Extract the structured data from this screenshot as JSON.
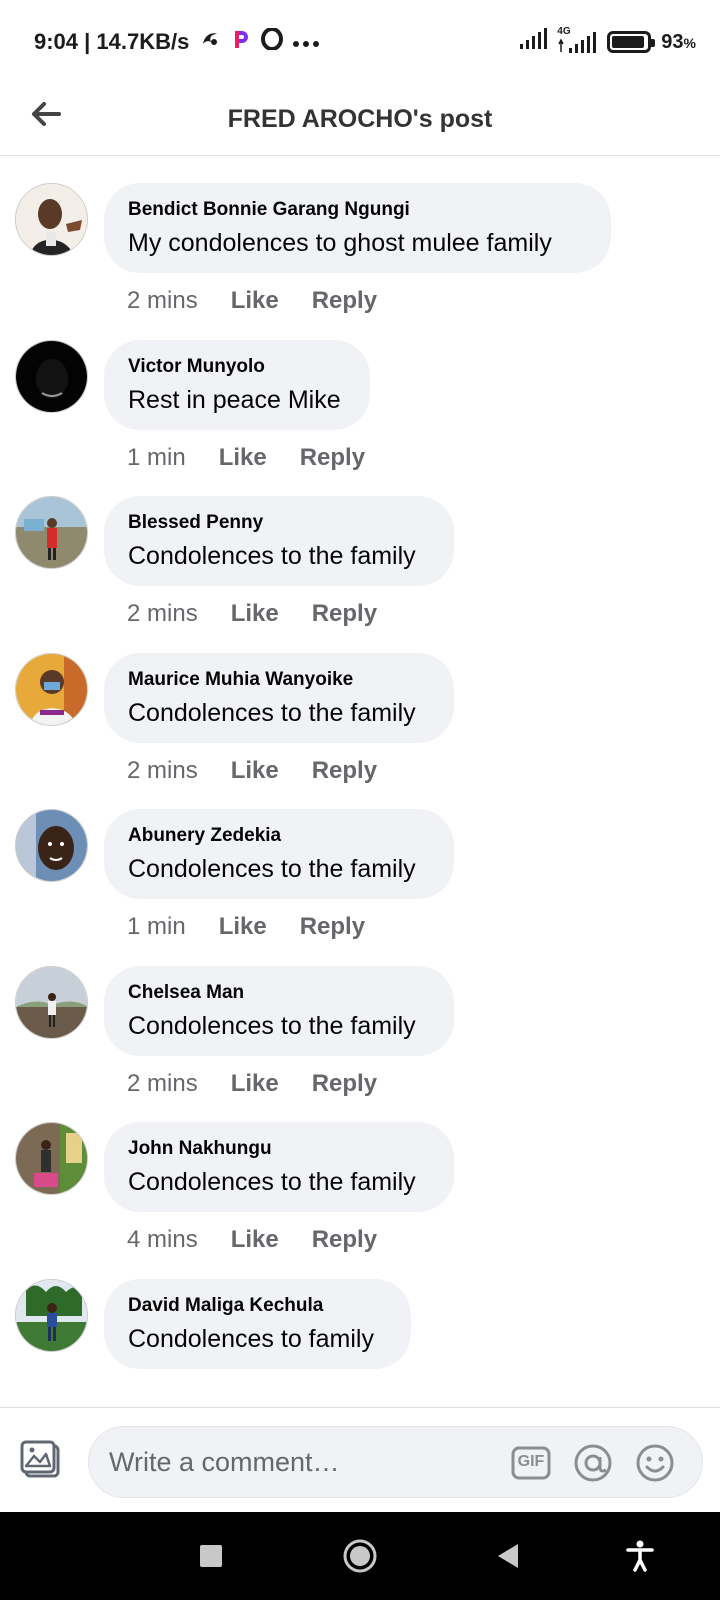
{
  "status_bar": {
    "time_speed": "9:04 | 14.7KB/s",
    "network": "4G",
    "battery_percent": "93",
    "battery_unit": "%",
    "battery_level": 0.93
  },
  "header": {
    "title": "FRED AROCHO's post"
  },
  "comments": [
    {
      "name": "Bendict Bonnie Garang Ngungi",
      "text": "My condolences to ghost mulee family",
      "time": "2 mins",
      "like": "Like",
      "reply": "Reply"
    },
    {
      "name": "Victor Munyolo",
      "text": "Rest in peace Mike",
      "time": "1 min",
      "like": "Like",
      "reply": "Reply"
    },
    {
      "name": "Blessed Penny",
      "text": "Condolences to the family",
      "time": "2 mins",
      "like": "Like",
      "reply": "Reply"
    },
    {
      "name": "Maurice Muhia Wanyoike",
      "text": "Condolences to the family",
      "time": "2 mins",
      "like": "Like",
      "reply": "Reply"
    },
    {
      "name": "Abunery Zedekia",
      "text": "Condolences to the family",
      "time": "1 min",
      "like": "Like",
      "reply": "Reply"
    },
    {
      "name": "Chelsea Man",
      "text": "Condolences to the family",
      "time": "2 mins",
      "like": "Like",
      "reply": "Reply"
    },
    {
      "name": "John Nakhungu",
      "text": "Condolences to the family",
      "time": "4 mins",
      "like": "Like",
      "reply": "Reply"
    },
    {
      "name": "David Maliga Kechula",
      "text": "Condolences to family"
    }
  ],
  "composer": {
    "placeholder": "Write a comment…",
    "gif_label": "GIF"
  },
  "icons": {
    "back": "arrow-left-icon",
    "photo": "photo-icon",
    "gif": "gif-icon",
    "mention": "at-sign-icon",
    "emoji": "emoji-icon",
    "nav_recents": "square-icon",
    "nav_home": "circle-icon",
    "nav_back": "triangle-back-icon",
    "accessibility": "accessibility-icon"
  }
}
